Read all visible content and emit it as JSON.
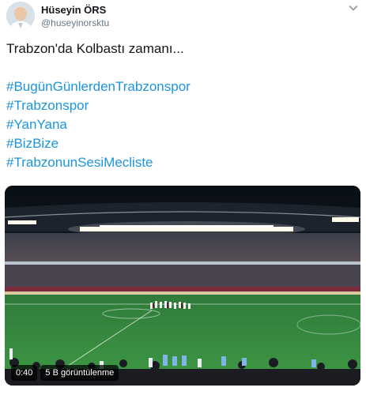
{
  "author": {
    "name": "Hüseyin ÖRS",
    "handle": "@huseyinorsktu"
  },
  "tweet": {
    "text": "Trabzon'da Kolbastı zamanı...",
    "hashtags": [
      "#BugünGünlerdenTrabzonspor",
      "#Trabzonspor",
      "#YanYana",
      "#BizBize",
      "#TrabzonunSesiMecliste"
    ]
  },
  "video": {
    "duration": "0:40",
    "views": "5 B görüntülenme"
  },
  "icons": {
    "menu": "chevron-down-icon"
  },
  "colors": {
    "hashtag": "#1b95e0",
    "name": "#14171a",
    "handle": "#657786"
  }
}
